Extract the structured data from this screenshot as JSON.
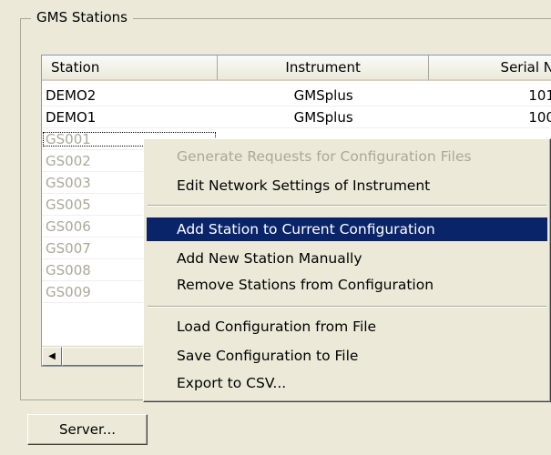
{
  "group": {
    "title": "GMS Stations"
  },
  "list": {
    "columns": [
      "Station",
      "Instrument",
      "Serial N"
    ],
    "rows": [
      {
        "station": "DEMO2",
        "instrument": "GMSplus",
        "serial": "101"
      },
      {
        "station": "DEMO1",
        "instrument": "GMSplus",
        "serial": "100"
      },
      {
        "station": "GS001",
        "instrument": "",
        "serial": ""
      },
      {
        "station": "GS002",
        "instrument": "",
        "serial": ""
      },
      {
        "station": "GS003",
        "instrument": "",
        "serial": ""
      },
      {
        "station": "GS005",
        "instrument": "",
        "serial": ""
      },
      {
        "station": "GS006",
        "instrument": "",
        "serial": ""
      },
      {
        "station": "GS007",
        "instrument": "",
        "serial": ""
      },
      {
        "station": "GS008",
        "instrument": "",
        "serial": ""
      },
      {
        "station": "GS009",
        "instrument": "",
        "serial": ""
      }
    ]
  },
  "context_menu": {
    "items": [
      {
        "label": "Generate Requests for Configuration Files",
        "state": "disabled"
      },
      {
        "label": "Edit Network Settings of Instrument",
        "state": "normal"
      },
      {
        "label": "Add Station to Current Configuration",
        "state": "selected"
      },
      {
        "label": "Add New Station Manually",
        "state": "normal"
      },
      {
        "label": "Remove Stations from Configuration",
        "state": "normal"
      },
      {
        "label": "Load Configuration from File",
        "state": "normal"
      },
      {
        "label": "Save Configuration to File",
        "state": "normal"
      },
      {
        "label": "Export to CSV...",
        "state": "normal"
      }
    ]
  },
  "buttons": {
    "server": "Server..."
  },
  "colors": {
    "selection": "#0a246a",
    "disabled_text": "#aca899",
    "face": "#ece9d8"
  }
}
